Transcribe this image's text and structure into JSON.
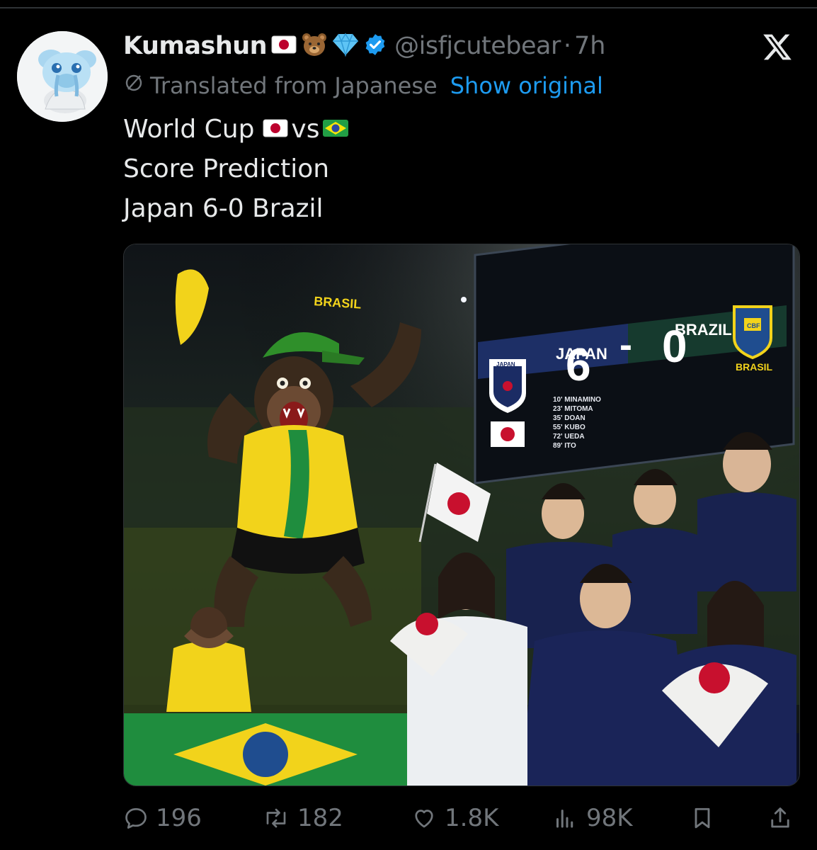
{
  "tweet": {
    "display_name": "Kumashun",
    "handle": "@isfjcutebear",
    "separator": "·",
    "time": "7h",
    "translated_label": "Translated from Japanese",
    "show_original": "Show original",
    "line1_prefix": "World Cup",
    "line1_vs": "vs",
    "line2": "Score Prediction",
    "line3": "Japan 6-0 Brazil",
    "badges": [
      "japan-flag",
      "bear-emoji",
      "diamond-emoji",
      "verified-badge"
    ]
  },
  "image": {
    "cap_text": "BRASIL",
    "scoreboard": {
      "home": "JAPAN",
      "away": "BRAZIL",
      "home_score": "6",
      "dash": "-",
      "away_score": "0",
      "home_crest": "JAPAN",
      "away_crest": "CBF",
      "away_label": "BRASIL",
      "scorers": [
        "10' MINAMINO",
        "23' MITOMA",
        "35' DOAN",
        "55' KUBO",
        "72' UEDA",
        "89' ITO"
      ]
    },
    "banner_text": "BRASIL"
  },
  "actions": {
    "replies": "196",
    "reposts": "182",
    "likes": "1.8K",
    "views": "98K"
  },
  "colors": {
    "link": "#1d9bf0",
    "muted": "#71767b",
    "text": "#e7e9ea",
    "verified": "#1d9bf0"
  }
}
